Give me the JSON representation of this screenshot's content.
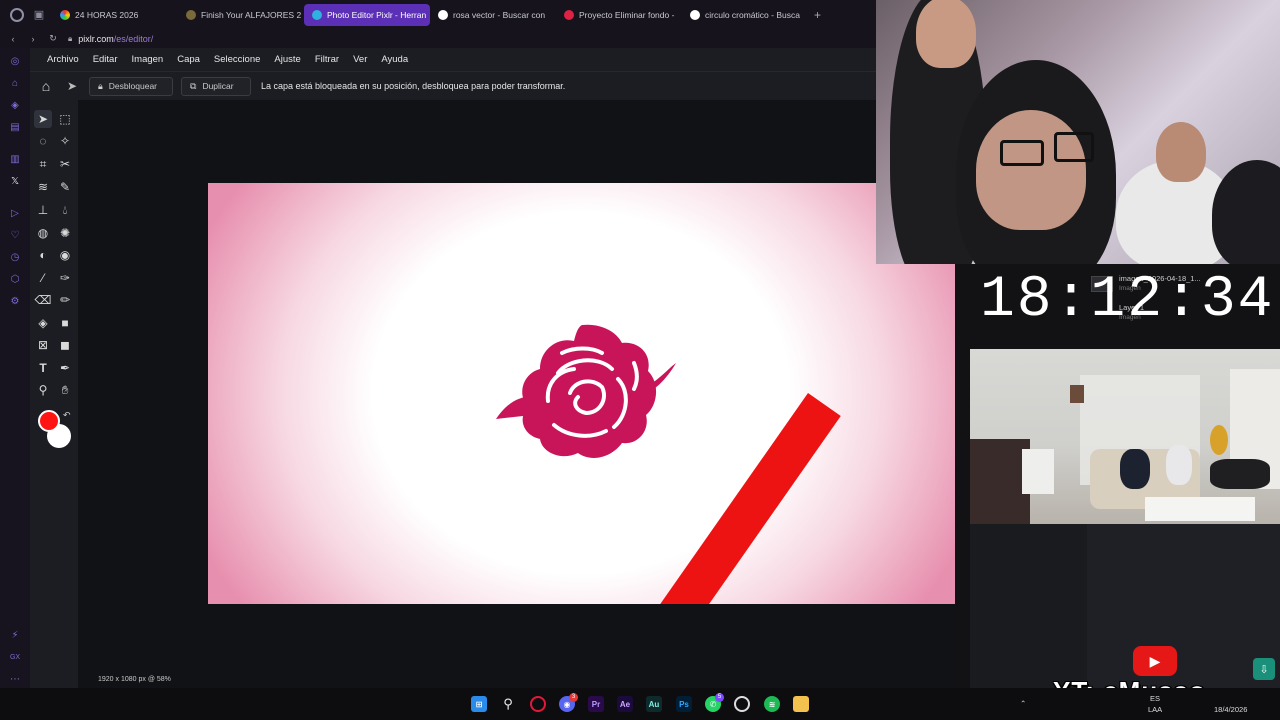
{
  "browser": {
    "tabs": [
      {
        "label": "24 HORAS 2026",
        "active": false
      },
      {
        "label": "Finish Your ALFAJORES 2",
        "active": false
      },
      {
        "label": "Photo Editor Pixlr - Herran",
        "active": true
      },
      {
        "label": "rosa vector - Buscar con",
        "active": false
      },
      {
        "label": "Proyecto Eliminar fondo -",
        "active": false
      },
      {
        "label": "circulo cromático - Busca",
        "active": false
      }
    ],
    "url_host": "pixlr.com",
    "url_path": "/es/editor/"
  },
  "menu": [
    "Archivo",
    "Editar",
    "Imagen",
    "Capa",
    "Seleccione",
    "Ajuste",
    "Filtrar",
    "Ver",
    "Ayuda"
  ],
  "options": {
    "unlock_label": "Desbloquear",
    "duplicate_label": "Duplicar",
    "message": "La capa está bloqueada en su posición, desbloquea para poder transformar."
  },
  "status": {
    "canvas_info": "1920 x 1080 px @ 58%"
  },
  "colors": {
    "foreground": "#ff1414",
    "background": "#ffffff",
    "accent": "#5b2fb6",
    "rose": "#c8155a",
    "stripe": "#ee1313"
  },
  "layers": [
    {
      "name": "imagen_2026-04-18_1...",
      "type": "Imagen"
    },
    {
      "name": "Layer 1",
      "type": "Imagen"
    }
  ],
  "stream": {
    "clock": "18:12:34",
    "channel": "YT: cMusso"
  },
  "taskbar": {
    "lang": "ES",
    "lang_sub": "LAA",
    "date": "18/4/2026",
    "app_labels": [
      "Pr",
      "Ae",
      "Au",
      "Ps"
    ],
    "badges": {
      "discord": "3",
      "whatsapp": "5"
    }
  }
}
